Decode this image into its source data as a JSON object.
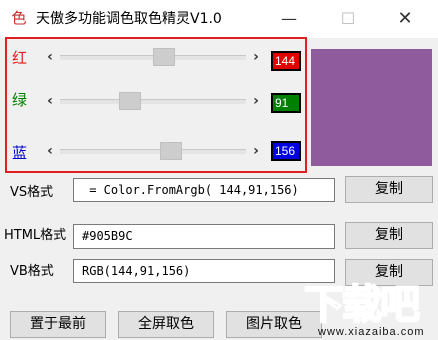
{
  "window": {
    "title": "天傲多功能调色取色精灵V1.0",
    "icon": "color-icon",
    "icon_glyph": "色",
    "minimize_glyph": "—",
    "maximize_glyph": "☐",
    "close_glyph": "✕"
  },
  "channels": [
    {
      "label": "红",
      "label_color": "#e02020",
      "value": "144",
      "value_bg": "#e00000"
    },
    {
      "label": "绿",
      "label_color": "#008000",
      "value": "91",
      "value_bg": "#008000"
    },
    {
      "label": "蓝",
      "label_color": "#0000cc",
      "value": "156",
      "value_bg": "#0000e0"
    }
  ],
  "slider": {
    "left_arrow": "‹",
    "right_arrow": "›",
    "max": 255
  },
  "preview_color": "#905B9C",
  "outputs": {
    "vs": {
      "label": "VS格式",
      "value": " = Color.FromArgb( 144,91,156)",
      "button": "复制"
    },
    "html": {
      "label": "HTML格式",
      "value": "#905B9C",
      "button": "复制"
    },
    "vb": {
      "label": "VB格式",
      "value": "RGB(144,91,156)",
      "button": "复制"
    }
  },
  "bottom_buttons": {
    "topmost": "置于最前",
    "fullscreen_pick": "全屏取色",
    "image_pick": "图片取色"
  },
  "watermark": {
    "main": "下载吧",
    "sub": "www.xiazaiba.com"
  }
}
